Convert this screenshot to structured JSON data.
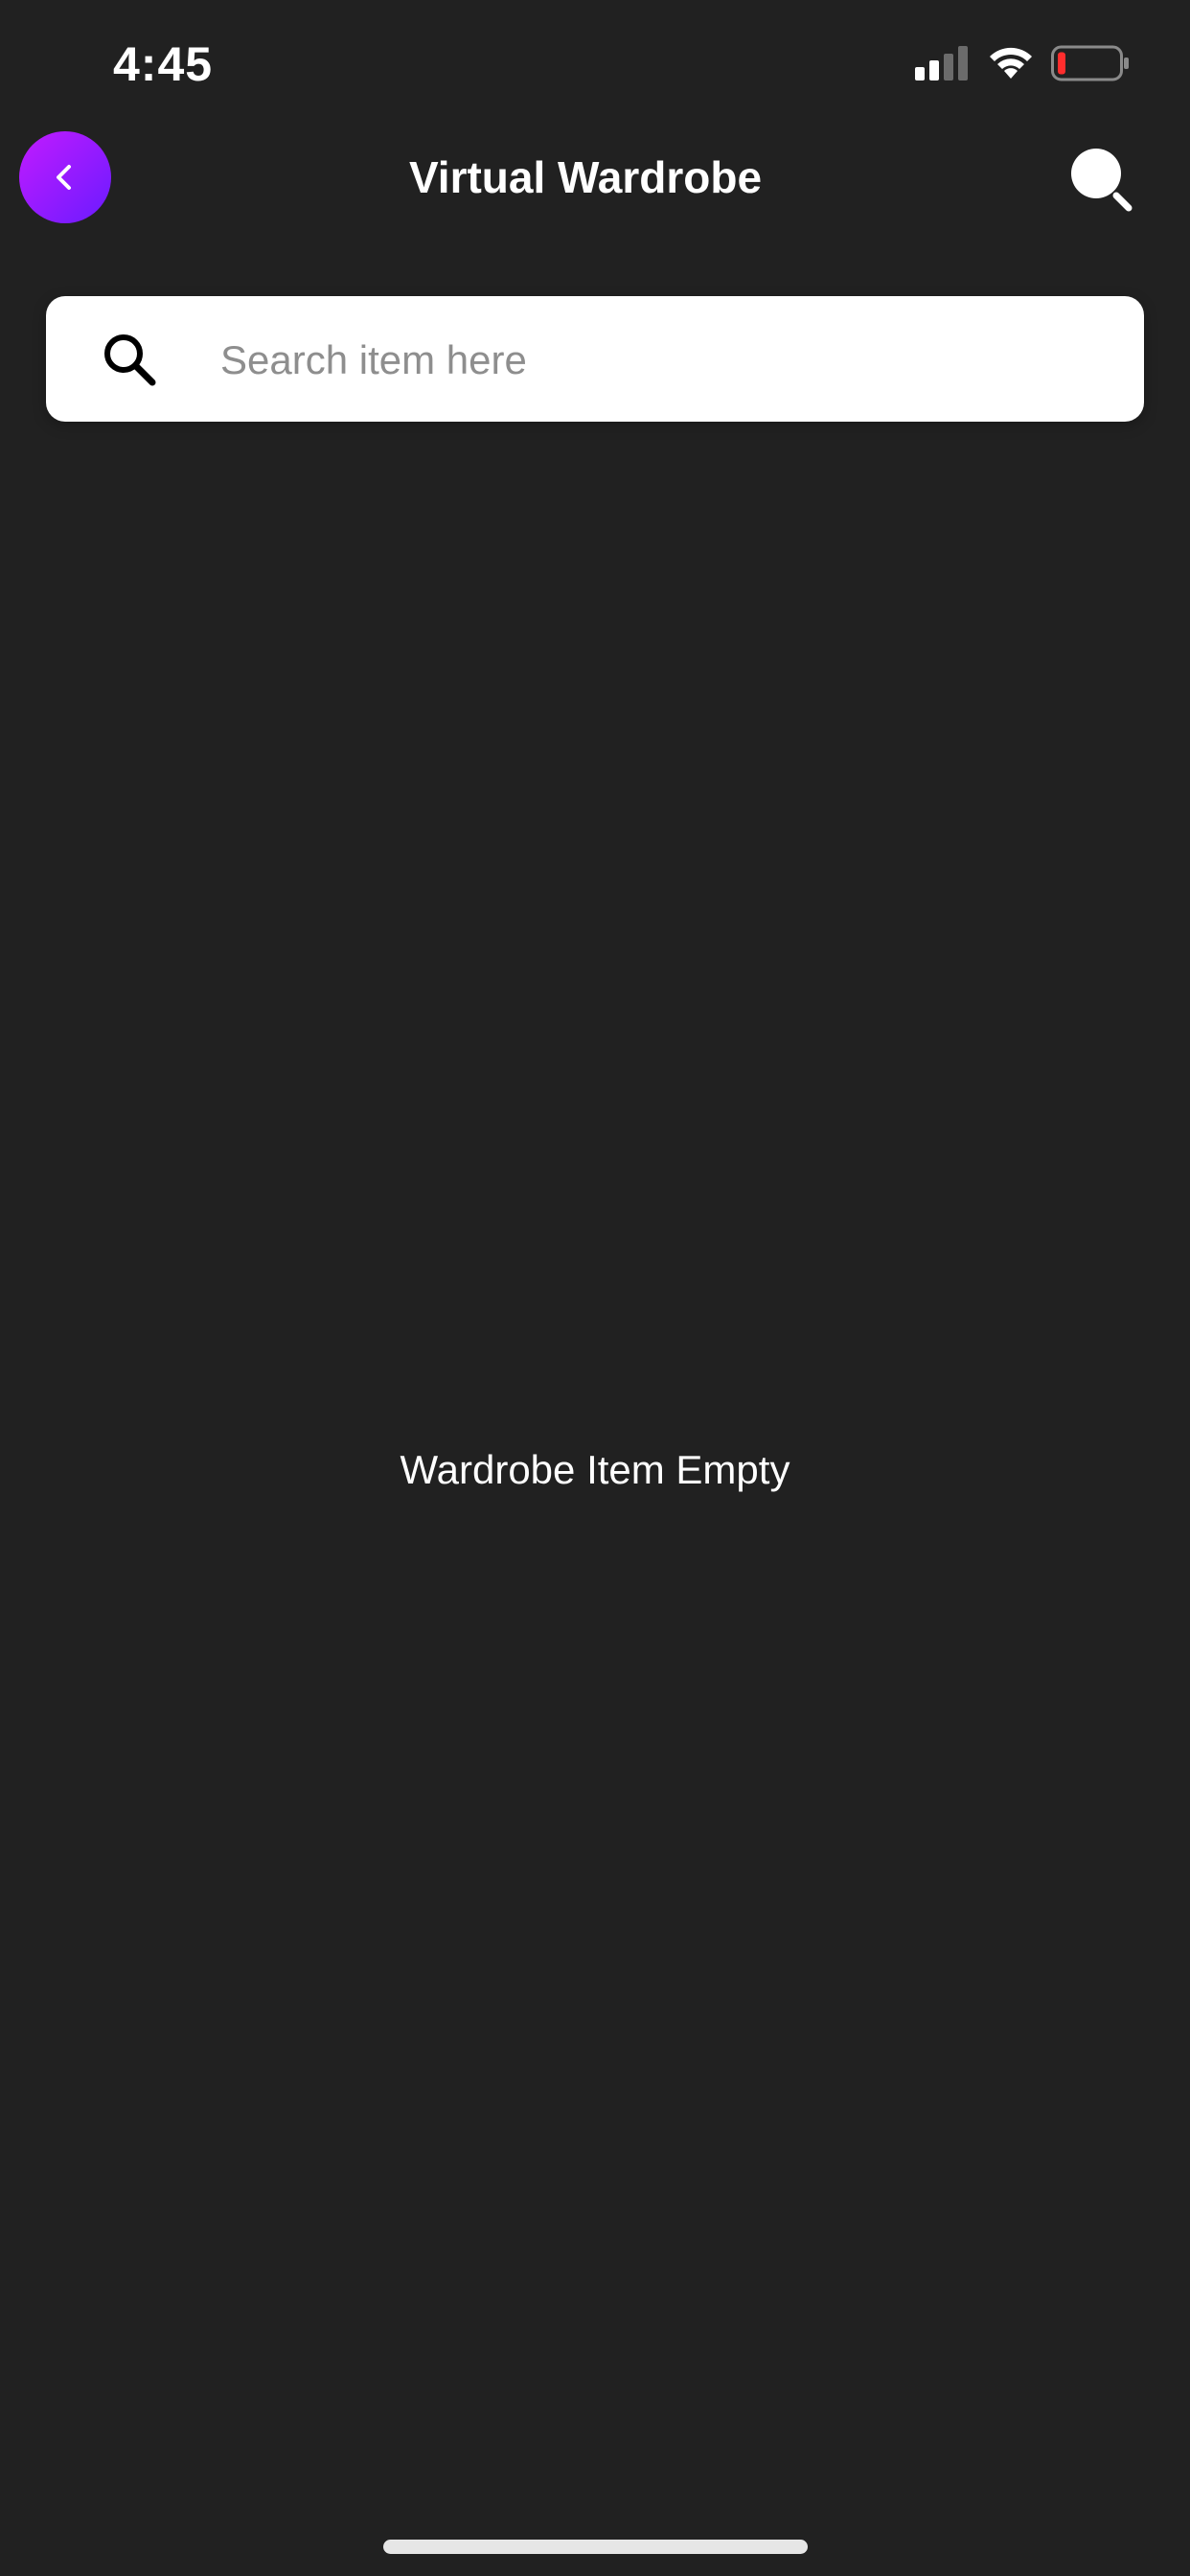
{
  "status_bar": {
    "time": "4:45",
    "icons": [
      "signal-icon",
      "wifi-icon",
      "battery-icon"
    ],
    "battery_level_color": "#ff2d2d"
  },
  "header": {
    "title": "Virtual Wardrobe",
    "back_icon": "chevron-left-icon",
    "search_icon": "search-icon",
    "accent_gradient": [
      "#c21bff",
      "#6a1bff"
    ]
  },
  "search": {
    "placeholder": "Search item here",
    "value": "",
    "icon": "search-icon"
  },
  "empty_state": {
    "message": "Wardrobe Item Empty"
  },
  "colors": {
    "background": "#212121",
    "text": "#ffffff",
    "search_background": "#ffffff",
    "placeholder": "#8e8e8e"
  }
}
